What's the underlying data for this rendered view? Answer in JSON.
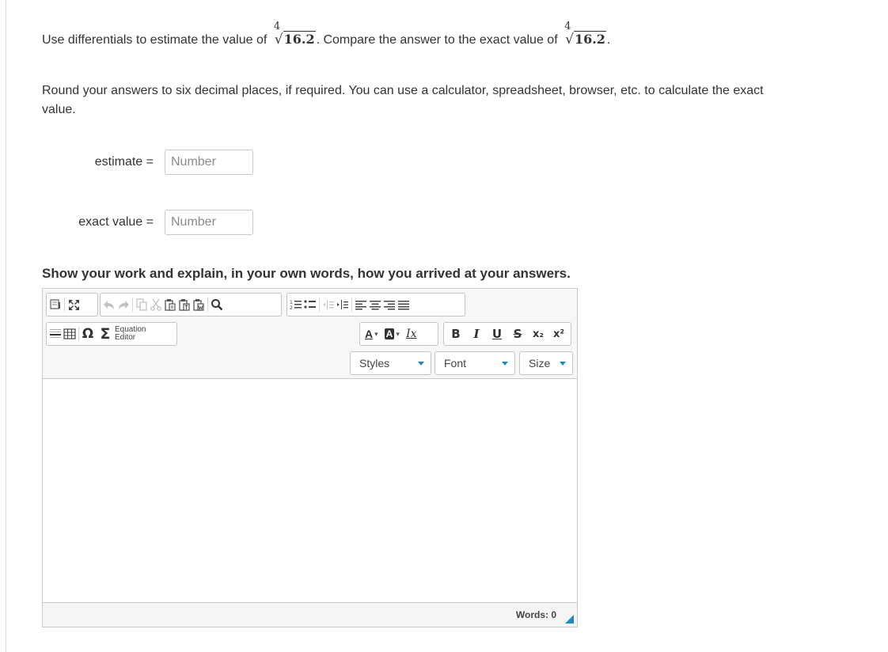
{
  "question": {
    "part1": "Use differentials to estimate the value of",
    "radical": {
      "index": "4",
      "radicand": "16.2"
    },
    "part2": ". Compare the answer to the exact value of",
    "part3": "."
  },
  "instructions": "Round your answers to six decimal places, if required. You can use a calculator, spreadsheet, browser, etc. to calculate the exact value.",
  "answers": [
    {
      "label": "estimate =",
      "value": "",
      "placeholder": "Number"
    },
    {
      "label": "exact value =",
      "value": "",
      "placeholder": "Number"
    }
  ],
  "work_heading": "Show your work and explain, in your own words, how you arrived at your answers.",
  "editor": {
    "toolbar": {
      "equation_editor_line1": "Equation",
      "equation_editor_line2": "Editor",
      "styles_label": "Styles",
      "font_label": "Font",
      "size_label": "Size",
      "glyphs": {
        "omega": "Ω",
        "sigma": "Σ",
        "bold": "B",
        "italic": "I",
        "underline": "U",
        "strike": "S",
        "subscript": "x₂",
        "superscript": "x²",
        "font_color": "A",
        "bg_color": "A",
        "remove_format": "Ix"
      }
    },
    "content": "",
    "word_count_label": "Words: 0"
  },
  "colors": {
    "accent": "#1a8bc7",
    "border": "#c9c9c9",
    "text": "#333333",
    "toolbar_bg": "#f7f7f7"
  }
}
